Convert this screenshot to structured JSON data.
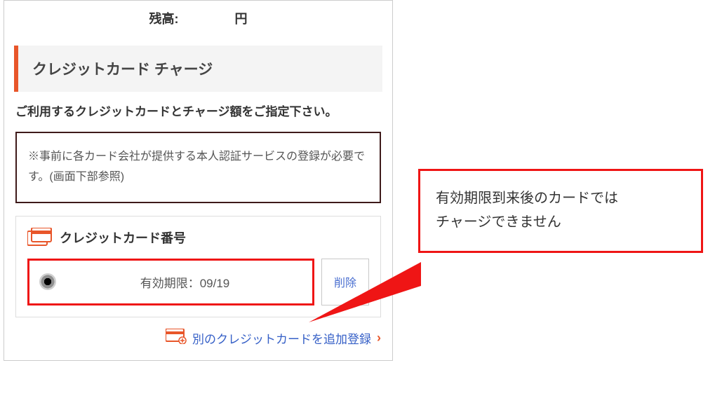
{
  "balance": {
    "label": "残高:",
    "currency": "円"
  },
  "header": {
    "title": "クレジットカード チャージ"
  },
  "instructions": "ご利用するクレジットカードとチャージ額をご指定下さい。",
  "notice": "※事前に各カード会社が提供する本人認証サービスの登録が必要です。(画面下部参照)",
  "card_section": {
    "title": "クレジットカード番号",
    "rows": [
      {
        "expiry_label": "有効期限：",
        "expiry_value": "09/19",
        "delete_label": "削除"
      }
    ],
    "add_link": "別のクレジットカードを追加登録"
  },
  "callout": {
    "line1": "有効期限到来後のカードでは",
    "line2": "チャージできません"
  },
  "colors": {
    "accent": "#e8562a",
    "alert": "#ef1515",
    "link": "#3660c7"
  }
}
